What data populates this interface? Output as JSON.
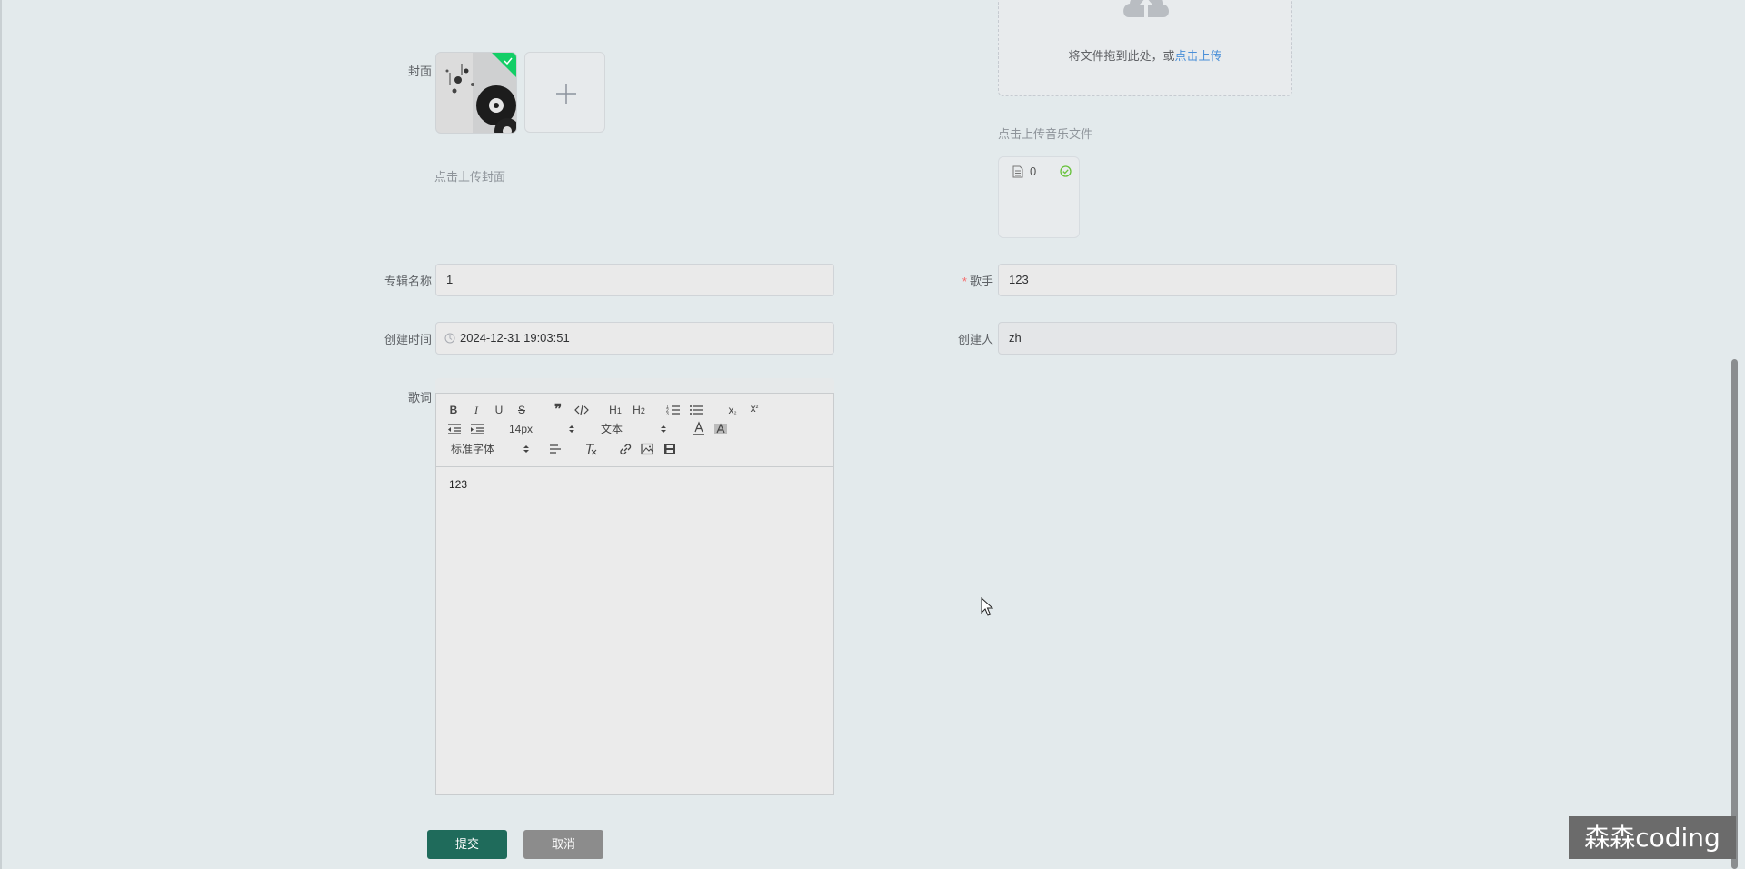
{
  "upload": {
    "drop_text": "将文件拖到此处，或",
    "drop_link": "点击上传",
    "music_tip": "点击上传音乐文件",
    "music_file_name": "0"
  },
  "cover": {
    "label": "封面",
    "tip": "点击上传封面"
  },
  "form": {
    "album_label": "专辑名称",
    "album_value": "1",
    "singer_required_mark": "*",
    "singer_label": "歌手",
    "singer_value": "123",
    "time_label": "创建时间",
    "time_value": "2024-12-31 19:03:51",
    "creator_label": "创建人",
    "creator_value": "zh",
    "lyrics_label": "歌词"
  },
  "editor": {
    "font_size": "14px",
    "header": "文本",
    "font_family": "标准字体",
    "content": "123"
  },
  "buttons": {
    "submit": "提交",
    "cancel": "取消"
  },
  "watermark": "森森coding",
  "colors": {
    "background": "#e3eaec",
    "primary_button": "#1f6b5b",
    "cancel_button": "#8c8c8c",
    "link": "#4a8fd8",
    "success": "#13ce66",
    "required": "#f56c6c"
  },
  "icons": [
    "upload-cloud-icon",
    "file-doc-icon",
    "success-circle-icon",
    "check-icon",
    "plus-icon",
    "clock-icon",
    "cursor-icon"
  ]
}
